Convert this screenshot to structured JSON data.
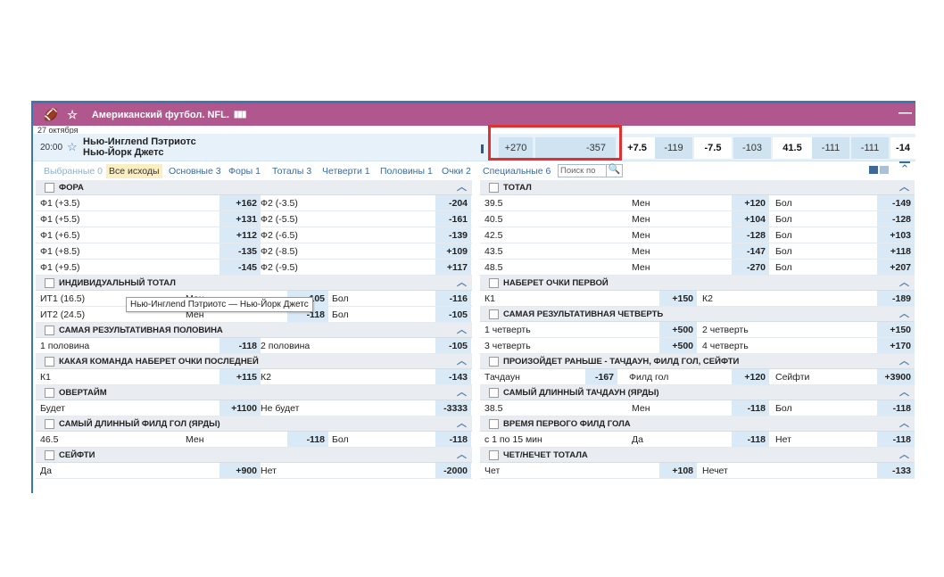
{
  "header": {
    "sport_title": "Американский футбол. NFL.",
    "sport_icon": "football-icon",
    "fav_icon": "star-icon",
    "stats_icon": "bar-chart-icon",
    "minimize": "—"
  },
  "match": {
    "date": "27 октября",
    "time": "20:00",
    "team1": "Нью-Инглend Пэтриотс",
    "team2": "Нью-Йорк Джетс",
    "cells": [
      "+270",
      "",
      "-357",
      "+7.5",
      "-119",
      "-7.5",
      "-103",
      "41.5",
      "-111",
      "-111",
      "-14"
    ]
  },
  "tabs": [
    "Выбранные 0",
    "Все исходы",
    "Основные 3",
    "Форы 1",
    "Тоталы 3",
    "Четверти 1",
    "Половины 1",
    "Очки 2",
    "Специальные 6"
  ],
  "search": {
    "placeholder": "Поиск по"
  },
  "tooltip": "Нью-Инглend Пэтриотс — Нью-Йорк Джетс",
  "left_sections": [
    {
      "title": "ФОРА",
      "rows": [
        [
          "Ф1 (+3.5)",
          "+162",
          "Ф2 (-3.5)",
          "-204"
        ],
        [
          "Ф1 (+5.5)",
          "+131",
          "Ф2 (-5.5)",
          "-161"
        ],
        [
          "Ф1 (+6.5)",
          "+112",
          "Ф2 (-6.5)",
          "-139"
        ],
        [
          "Ф1 (+8.5)",
          "-135",
          "Ф2 (-8.5)",
          "+109"
        ],
        [
          "Ф1 (+9.5)",
          "-145",
          "Ф2 (-9.5)",
          "+117"
        ]
      ]
    },
    {
      "title": "ИНДИВИДУАЛЬНЫЙ ТОТАЛ",
      "rows4": [
        [
          "ИТ1 (16.5)",
          "Мен",
          "-105",
          "Бол",
          "-116"
        ],
        [
          "ИТ2 (24.5)",
          "Мен",
          "-118",
          "Бол",
          "-105"
        ]
      ]
    },
    {
      "title": "САМАЯ РЕЗУЛЬТАТИВНАЯ ПОЛОВИНА",
      "rows": [
        [
          "1 половина",
          "-118",
          "2 половина",
          "-105"
        ]
      ]
    },
    {
      "title": "КАКАЯ КОМАНДА НАБЕРЕТ ОЧКИ ПОСЛЕДНЕЙ",
      "rows": [
        [
          "К1",
          "+115",
          "К2",
          "-143"
        ]
      ]
    },
    {
      "title": "ОВЕРТАЙМ",
      "rows": [
        [
          "Будет",
          "+1100",
          "Не будет",
          "-3333"
        ]
      ]
    },
    {
      "title": "САМЫЙ ДЛИННЫЙ ФИЛД ГОЛ (ЯРДЫ)",
      "rows4": [
        [
          "46.5",
          "Мен",
          "-118",
          "Бол",
          "-118"
        ]
      ]
    },
    {
      "title": "СЕЙФТИ",
      "rows": [
        [
          "Да",
          "+900",
          "Нет",
          "-2000"
        ]
      ]
    }
  ],
  "right_sections": [
    {
      "title": "ТОТАЛ",
      "rows4": [
        [
          "39.5",
          "Мен",
          "+120",
          "Бол",
          "-149"
        ],
        [
          "40.5",
          "Мен",
          "+104",
          "Бол",
          "-128"
        ],
        [
          "42.5",
          "Мен",
          "-128",
          "Бол",
          "+103"
        ],
        [
          "43.5",
          "Мен",
          "-147",
          "Бол",
          "+118"
        ],
        [
          "48.5",
          "Мен",
          "-270",
          "Бол",
          "+207"
        ]
      ]
    },
    {
      "title": "НАБЕРЕТ ОЧКИ ПЕРВОЙ",
      "rows": [
        [
          "К1",
          "+150",
          "К2",
          "-189"
        ]
      ]
    },
    {
      "title": "САМАЯ РЕЗУЛЬТАТИВНАЯ ЧЕТВЕРТЬ",
      "rows": [
        [
          "1 четверть",
          "+500",
          "2 четверть",
          "+150"
        ],
        [
          "3 четверть",
          "+500",
          "4 четверть",
          "+170"
        ]
      ]
    },
    {
      "title": "ПРОИЗОЙДЕТ РАНЬШЕ - ТАЧДАУН, ФИЛД ГОЛ, СЕЙФТИ",
      "rows6": [
        [
          "Тачдаун",
          "-167",
          "Филд гол",
          "+120",
          "Сейфти",
          "+3900"
        ]
      ]
    },
    {
      "title": "САМЫЙ ДЛИННЫЙ ТАЧДАУН (ЯРДЫ)",
      "rows4": [
        [
          "38.5",
          "Мен",
          "-118",
          "Бол",
          "-118"
        ]
      ]
    },
    {
      "title": "ВРЕМЯ ПЕРВОГО ФИЛД ГОЛА",
      "rows4": [
        [
          "с 1 по 15 мин",
          "Да",
          "-118",
          "Нет",
          "-118"
        ]
      ]
    },
    {
      "title": "ЧЕТ/НЕЧЕТ ТОТАЛА",
      "rows": [
        [
          "Чет",
          "+108",
          "Нечет",
          "-133"
        ]
      ]
    }
  ]
}
